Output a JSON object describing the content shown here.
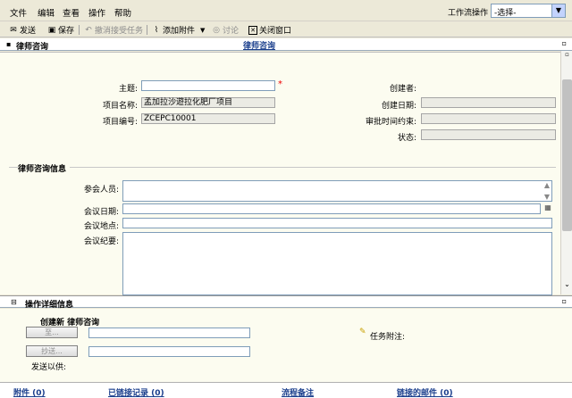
{
  "menu": {
    "file": "文件",
    "edit": "编辑",
    "view": "查看",
    "action": "操作",
    "help": "帮助",
    "workflow_label": "工作流操作",
    "workflow_select": "-选择-"
  },
  "toolbar": {
    "send": "发送",
    "save": "保存",
    "undo_accept": "撤消接受任务",
    "add_attachment": "添加附件",
    "discuss": "讨论",
    "close_window": "关闭窗口"
  },
  "section": {
    "title": "律师咨询",
    "tab": "律师咨询"
  },
  "form": {
    "subject_label": "主题:",
    "subject_value": "",
    "project_name_label": "项目名称:",
    "project_name_value": "孟加拉沙遊拉化肥厂项目",
    "project_code_label": "项目编号:",
    "project_code_value": "ZCEPC10001",
    "creator_label": "创建者:",
    "create_date_label": "创建日期:",
    "approval_deadline_label": "审批时间约束:",
    "status_label": "状态:"
  },
  "meeting": {
    "group_title": "律师咨询信息",
    "participants_label": "参会人员:",
    "date_label": "会议日期:",
    "place_label": "会议地点:",
    "minutes_label": "会议纪要:"
  },
  "operation": {
    "title": "操作详细信息",
    "create_new": "创建新 律师咨询",
    "to_button": "至...",
    "cc_button": "抄送...",
    "send_for_label": "发送以供:",
    "task_note_label": "任务附注:"
  },
  "bottom": {
    "attachments": "附件 (0)",
    "linked_records": "已链接记录 (0)",
    "procedure_notes": "流程备注",
    "linked_mails": "链接的邮件 (0)"
  },
  "colors": {
    "link_blue": "#1a3e8c",
    "required_red": "#e00000"
  }
}
